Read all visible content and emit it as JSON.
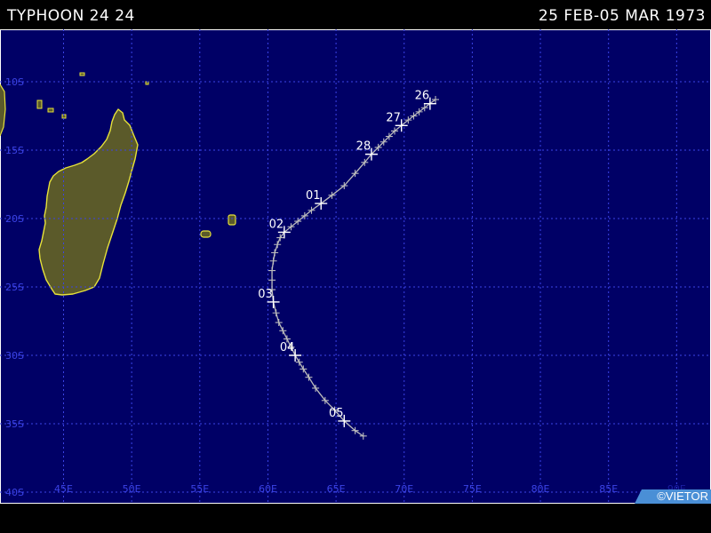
{
  "header": {
    "storm_title": "TYPHOON 24 24",
    "date_range": "25 FEB-05 MAR 1973"
  },
  "map": {
    "ocean_color": "#000066",
    "land_color": "#5b5a2a",
    "coast_color": "#e6e23a",
    "grid_color": "#3b43e6",
    "track_color": "#bcbcbc",
    "lat_labels": [
      "10S",
      "15S",
      "20S",
      "25S",
      "30S",
      "35S",
      "40S"
    ],
    "lon_labels": [
      "45E",
      "50E",
      "55E",
      "60E",
      "65E",
      "70E",
      "75E",
      "80E",
      "85E"
    ],
    "lon_labels_faded": [
      "90E"
    ],
    "credit": "©VIETOR"
  },
  "track": {
    "points": [
      [
        72.3,
        -11.3
      ],
      [
        71.9,
        -11.6
      ],
      [
        71.5,
        -11.9
      ],
      [
        71.1,
        -12.2
      ],
      [
        70.7,
        -12.5
      ],
      [
        70.3,
        -12.8
      ],
      [
        69.8,
        -13.2
      ],
      [
        69.3,
        -13.6
      ],
      [
        68.9,
        -14.0
      ],
      [
        68.5,
        -14.4
      ],
      [
        68.1,
        -14.8
      ],
      [
        67.6,
        -15.3
      ],
      [
        67.1,
        -15.9
      ],
      [
        66.4,
        -16.7
      ],
      [
        65.6,
        -17.6
      ],
      [
        64.7,
        -18.3
      ],
      [
        63.9,
        -18.9
      ],
      [
        63.2,
        -19.4
      ],
      [
        62.7,
        -19.8
      ],
      [
        62.2,
        -20.2
      ],
      [
        61.7,
        -20.6
      ],
      [
        61.2,
        -21.0
      ],
      [
        60.9,
        -21.4
      ],
      [
        60.7,
        -21.9
      ],
      [
        60.5,
        -22.5
      ],
      [
        60.4,
        -23.1
      ],
      [
        60.3,
        -23.8
      ],
      [
        60.3,
        -24.5
      ],
      [
        60.3,
        -25.2
      ],
      [
        60.4,
        -26.1
      ],
      [
        60.6,
        -26.9
      ],
      [
        60.8,
        -27.6
      ],
      [
        61.1,
        -28.2
      ],
      [
        61.4,
        -28.8
      ],
      [
        61.7,
        -29.4
      ],
      [
        62.0,
        -30.0
      ],
      [
        62.3,
        -30.5
      ],
      [
        62.6,
        -31.0
      ],
      [
        63.0,
        -31.6
      ],
      [
        63.5,
        -32.4
      ],
      [
        64.2,
        -33.3
      ],
      [
        64.9,
        -34.0
      ],
      [
        65.6,
        -34.8
      ],
      [
        66.4,
        -35.5
      ],
      [
        67.0,
        -35.9
      ]
    ],
    "day_markers": [
      {
        "label": "26",
        "lon": 71.9,
        "lat": -11.6
      },
      {
        "label": "27",
        "lon": 69.8,
        "lat": -13.2
      },
      {
        "label": "28",
        "lon": 67.6,
        "lat": -15.3
      },
      {
        "label": "01",
        "lon": 63.9,
        "lat": -18.9
      },
      {
        "label": "02",
        "lon": 61.2,
        "lat": -21.0
      },
      {
        "label": "03",
        "lon": 60.4,
        "lat": -26.1
      },
      {
        "label": "04",
        "lon": 62.0,
        "lat": -30.0
      },
      {
        "label": "05",
        "lon": 65.6,
        "lat": -34.8
      }
    ]
  }
}
